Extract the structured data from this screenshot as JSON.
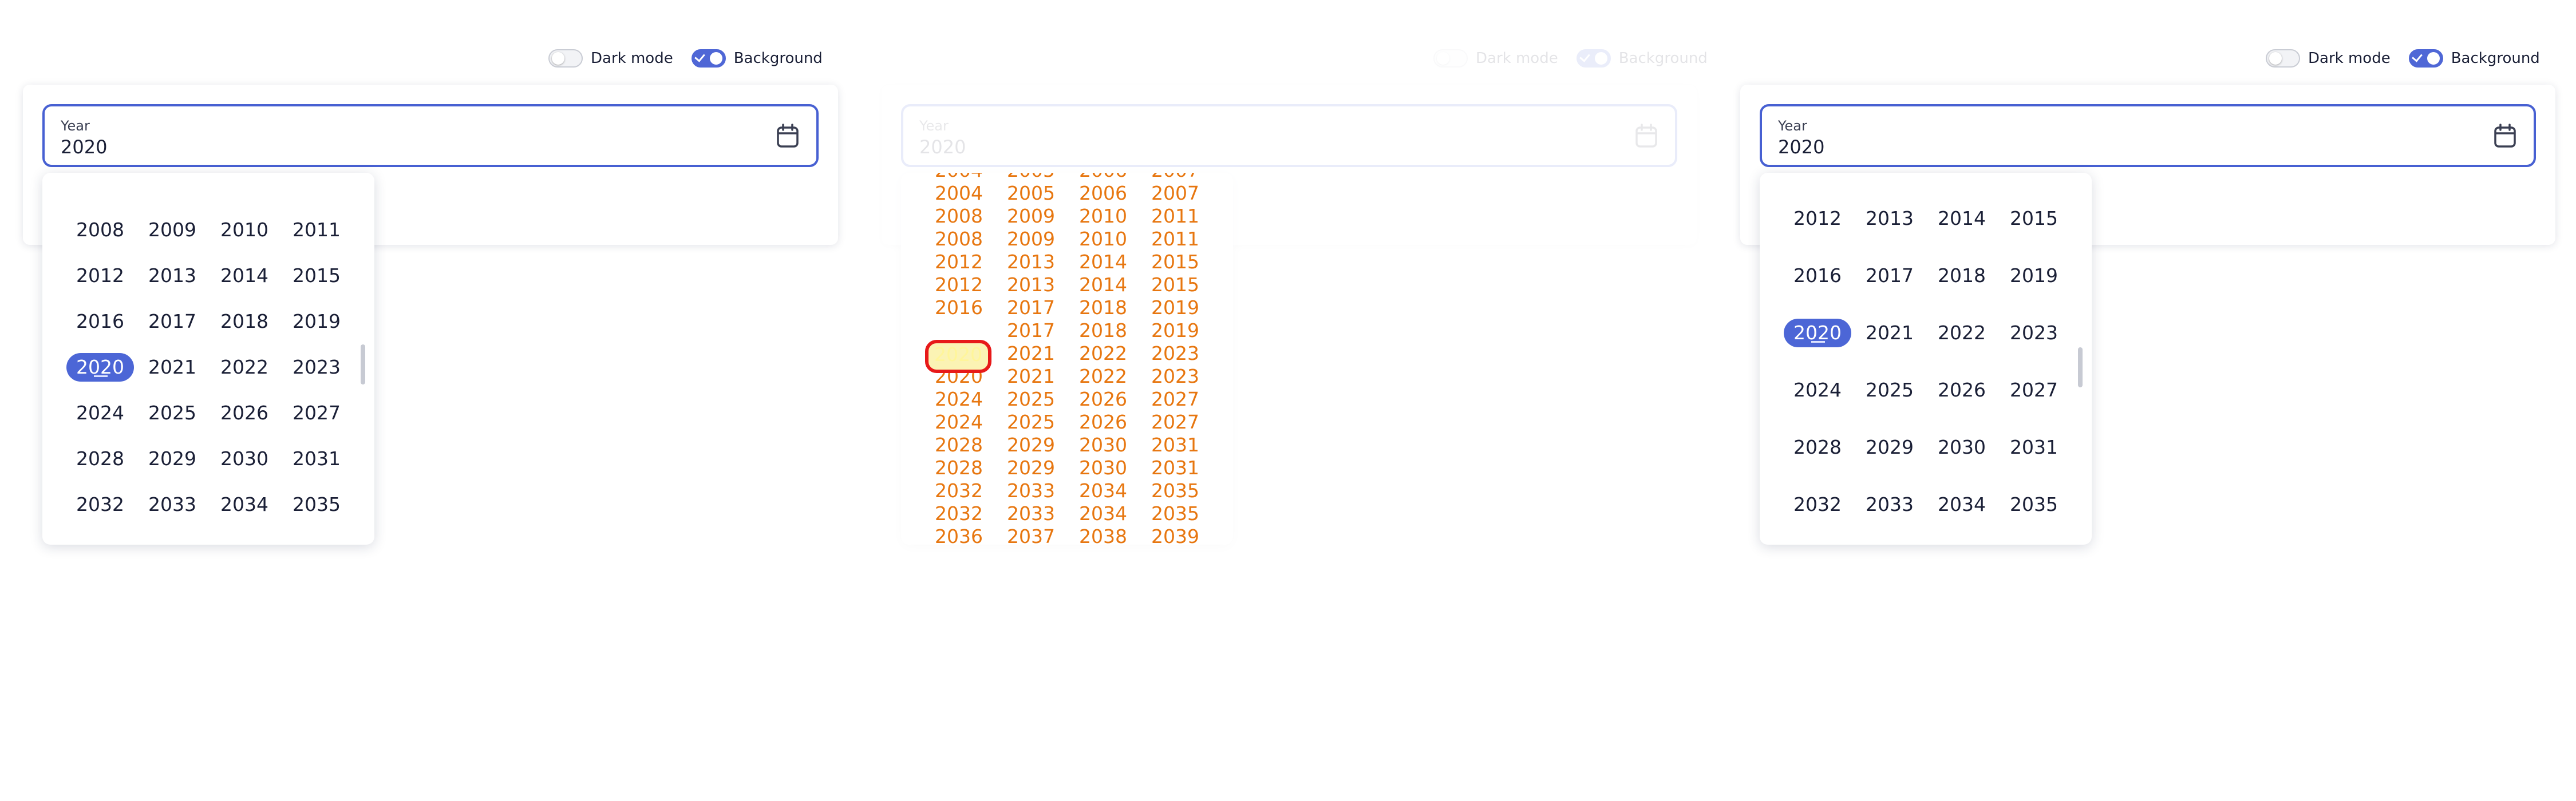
{
  "toggles": {
    "dark_mode_label": "Dark mode",
    "background_label": "Background",
    "dark_mode_on": false,
    "background_on": true
  },
  "field": {
    "label": "Year",
    "value": "2020"
  },
  "picker": {
    "selected_year": "2020",
    "years": [
      "2008",
      "2009",
      "2010",
      "2011",
      "2012",
      "2013",
      "2014",
      "2015",
      "2016",
      "2017",
      "2018",
      "2019",
      "2020",
      "2021",
      "2022",
      "2023",
      "2024",
      "2025",
      "2026",
      "2027",
      "2028",
      "2029",
      "2030",
      "2031",
      "2032",
      "2033",
      "2034",
      "2035"
    ],
    "years_overlay": [
      "2004",
      "2005",
      "2006",
      "2007",
      "2008",
      "2009",
      "2010",
      "2011",
      "2012",
      "2013",
      "2014",
      "2015",
      "2016",
      "2017",
      "2018",
      "2019",
      "2020",
      "2021",
      "2022",
      "2023",
      "2024",
      "2025",
      "2026",
      "2027",
      "2028",
      "2029",
      "2030",
      "2031",
      "2032",
      "2033",
      "2034",
      "2035",
      "2036",
      "2037",
      "2038",
      "2039"
    ]
  },
  "colors": {
    "accent": "#4c66d6",
    "field_border": "#4760d2",
    "overlay_text": "#e7760f",
    "overlay_ring": "#e71919"
  },
  "icons": [
    "calendar-icon",
    "check-icon"
  ]
}
